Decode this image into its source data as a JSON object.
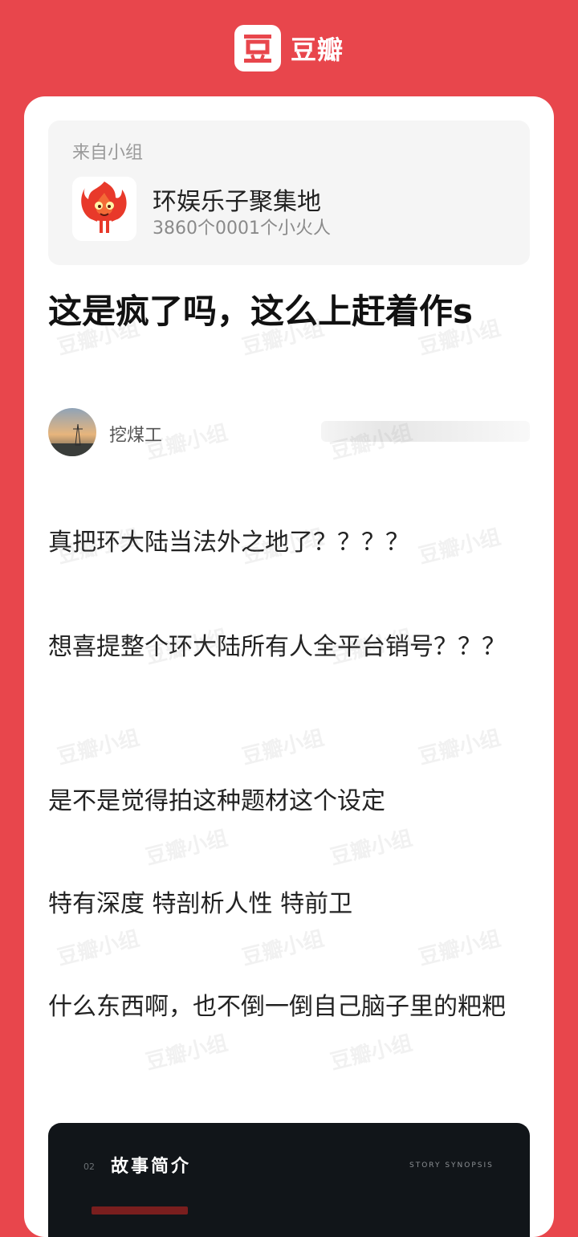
{
  "brand": {
    "logo_char": "豆",
    "name": "豆瓣"
  },
  "group": {
    "from_label": "来自小组",
    "name": "环娱乐子聚集地",
    "members": "3860个0001个小火人"
  },
  "post": {
    "title": "这是疯了吗，这么上赶着作s",
    "author": "挖煤工",
    "paragraphs": [
      "真把环大陆当法外之地了？？？？",
      "想喜提整个环大陆所有人全平台销号？？？",
      "是不是觉得拍这种题材这个设定",
      "特有深度 特剖析人性  特前卫",
      "什么东西啊，也不倒一倒自己脑子里的粑粑"
    ]
  },
  "preview": {
    "num": "02",
    "title": "故事简介",
    "subtitle": "STORY SYNOPSIS"
  },
  "watermark": "豆瓣小组",
  "colors": {
    "brand": "#e8464c",
    "card": "#ffffff",
    "group_bg": "#f5f5f5"
  }
}
